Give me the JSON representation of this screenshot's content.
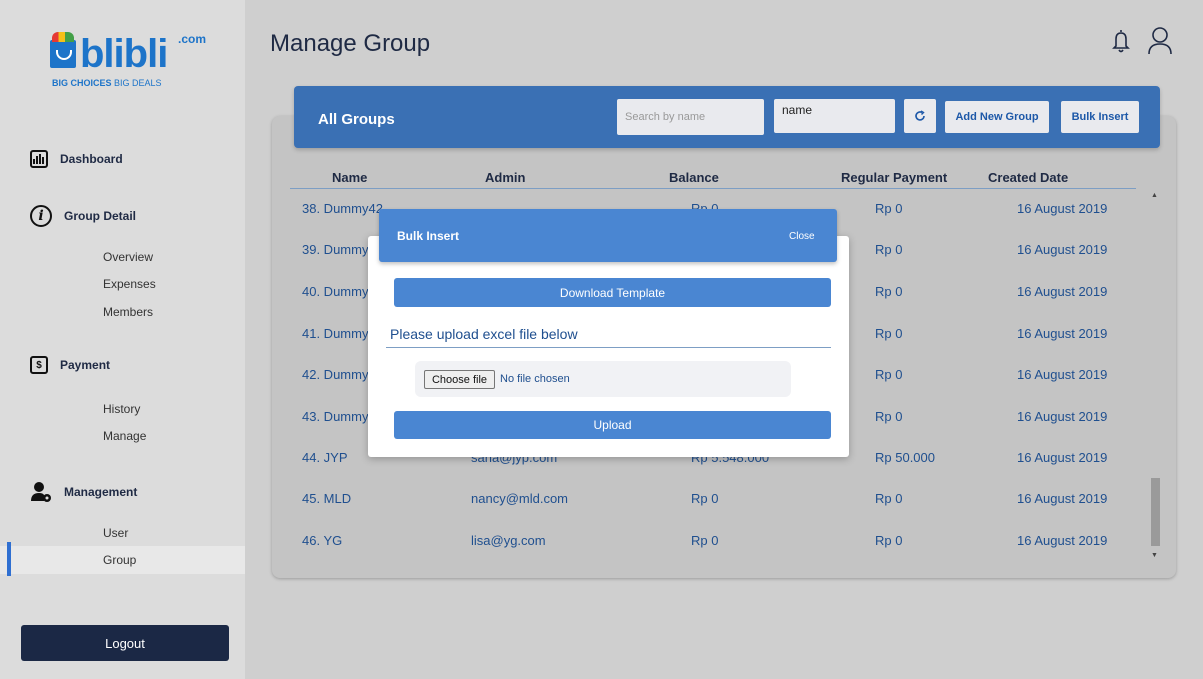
{
  "logo": {
    "wordmark": "blibli",
    "suffix": ".com",
    "tagline_bold": "BIG CHOICES",
    "tagline_light": "BIG DEALS"
  },
  "sidebar": {
    "sections": [
      {
        "label": "Dashboard",
        "icon": "dashboard-icon"
      },
      {
        "label": "Group Detail",
        "icon": "info-icon",
        "items": [
          "Overview",
          "Expenses",
          "Members"
        ]
      },
      {
        "label": "Payment",
        "icon": "payment-icon",
        "items": [
          "History",
          "Manage"
        ]
      },
      {
        "label": "Management",
        "icon": "management-icon",
        "items": [
          "User",
          "Group"
        ]
      }
    ],
    "active_item": "Group",
    "logout_label": "Logout"
  },
  "header": {
    "title": "Manage Group",
    "icons": [
      "bell-icon",
      "user-icon"
    ]
  },
  "card": {
    "title": "All Groups",
    "search_placeholder": "Search by name",
    "sort_select_value": "name",
    "add_button": "Add New Group",
    "bulk_button": "Bulk Insert"
  },
  "table": {
    "columns": [
      "Name",
      "Admin",
      "Balance",
      "Regular Payment",
      "Created Date"
    ],
    "rows": [
      {
        "name": "38.  Dummy42",
        "admin": "",
        "balance": "Rp 0",
        "regular": "Rp 0",
        "date": "16 August 2019"
      },
      {
        "name": "39.  Dummy",
        "admin": "",
        "balance": "",
        "regular": "Rp 0",
        "date": "16 August 2019"
      },
      {
        "name": "40.  Dummy",
        "admin": "",
        "balance": "",
        "regular": "Rp 0",
        "date": "16 August 2019"
      },
      {
        "name": "41.  Dummy",
        "admin": "",
        "balance": "",
        "regular": "Rp 0",
        "date": "16 August 2019"
      },
      {
        "name": "42.  Dummy",
        "admin": "",
        "balance": "",
        "regular": "Rp 0",
        "date": "16 August 2019"
      },
      {
        "name": "43.  Dummy",
        "admin": "",
        "balance": "",
        "regular": "Rp 0",
        "date": "16 August 2019"
      },
      {
        "name": "44.  JYP",
        "admin": "sana@jyp.com",
        "balance": "Rp 5.548.000",
        "regular": "Rp 50.000",
        "date": "16 August 2019"
      },
      {
        "name": "45.  MLD",
        "admin": "nancy@mld.com",
        "balance": "Rp 0",
        "regular": "Rp 0",
        "date": "16 August 2019"
      },
      {
        "name": "46.  YG",
        "admin": "lisa@yg.com",
        "balance": "Rp 0",
        "regular": "Rp 0",
        "date": "16 August 2019"
      }
    ]
  },
  "modal": {
    "title": "Bulk Insert",
    "close_label": "Close",
    "download_label": "Download Template",
    "upload_prompt": "Please upload excel file below",
    "choose_file_label": "Choose file",
    "no_file_text": "No file chosen",
    "upload_label": "Upload"
  },
  "colors": {
    "sidebar_bg": "#dcdcdc",
    "header_blue": "#3a70b4",
    "modal_blue": "#4a86d2",
    "logout_bg": "#1b2845",
    "brand_blue": "#1d74c9"
  }
}
